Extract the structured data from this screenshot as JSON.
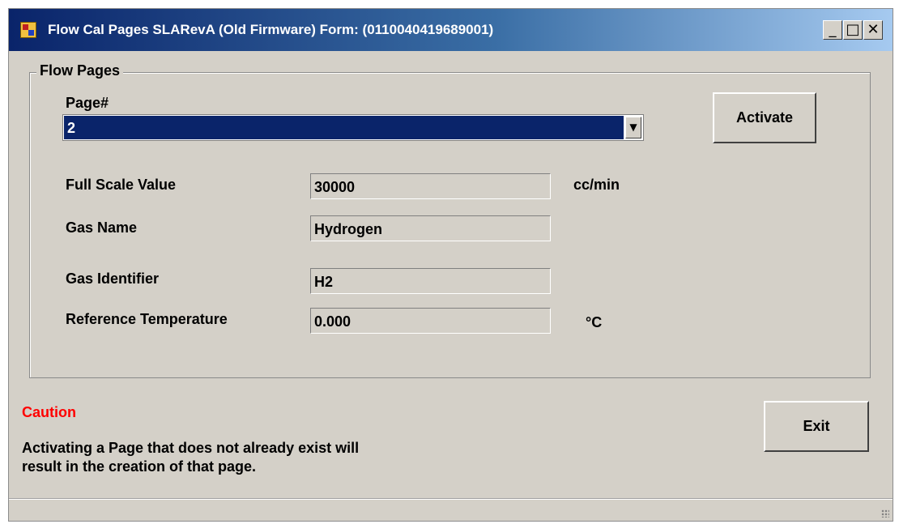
{
  "window": {
    "title": "Flow Cal Pages SLARevA (Old Firmware) Form: (0110040419689001)",
    "controls": {
      "minimize": "_",
      "maximize": "□",
      "close": "✕"
    }
  },
  "group": {
    "legend": "Flow Pages",
    "page_label": "Page#",
    "page_value": "2",
    "activate_label": "Activate",
    "fields": {
      "full_scale": {
        "label": "Full Scale Value",
        "value": "30000",
        "unit": "cc/min"
      },
      "gas_name": {
        "label": "Gas Name",
        "value": "Hydrogen"
      },
      "gas_id": {
        "label": "Gas Identifier",
        "value": "H2"
      },
      "ref_temp": {
        "label": "Reference Temperature",
        "value": "0.000",
        "unit": "°C"
      }
    }
  },
  "caution": {
    "title": "Caution",
    "line1": "Activating a Page that does not already exist will",
    "line2": "result in the creation of that page."
  },
  "exit_label": "Exit",
  "colors": {
    "caution": "#ff0000",
    "selection": "#0a246a",
    "face": "#d4d0c8"
  }
}
